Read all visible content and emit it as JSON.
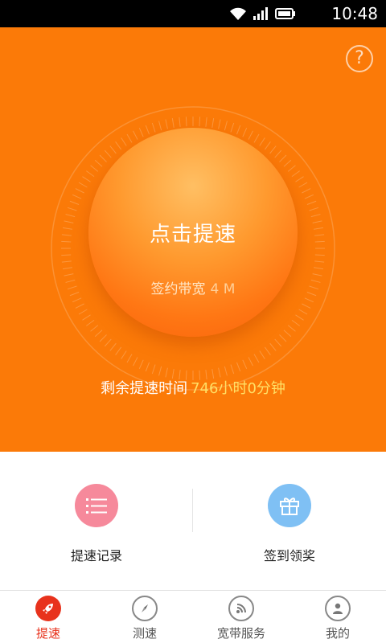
{
  "status_bar": {
    "time": "10:48"
  },
  "hero": {
    "help_symbol": "?",
    "boost_button_label": "点击提速",
    "bandwidth_label": "签约带宽",
    "bandwidth_value": "4 M",
    "remaining_label": "剩余提速时间",
    "remaining_value": "746小时0分钟"
  },
  "actions": [
    {
      "label": "提速记录",
      "icon": "list-icon",
      "color": "#f6899b"
    },
    {
      "label": "签到领奖",
      "icon": "gift-icon",
      "color": "#7fc0f4"
    }
  ],
  "nav": {
    "items": [
      {
        "label": "提速",
        "icon": "rocket-icon",
        "active": true
      },
      {
        "label": "测速",
        "icon": "compass-icon",
        "active": false
      },
      {
        "label": "宽带服务",
        "icon": "rss-icon",
        "active": false
      },
      {
        "label": "我的",
        "icon": "user-icon",
        "active": false
      }
    ]
  },
  "colors": {
    "hero_bg": "#fb7a08",
    "accent_red": "#e8321c",
    "highlight_yellow": "#ffe066"
  }
}
